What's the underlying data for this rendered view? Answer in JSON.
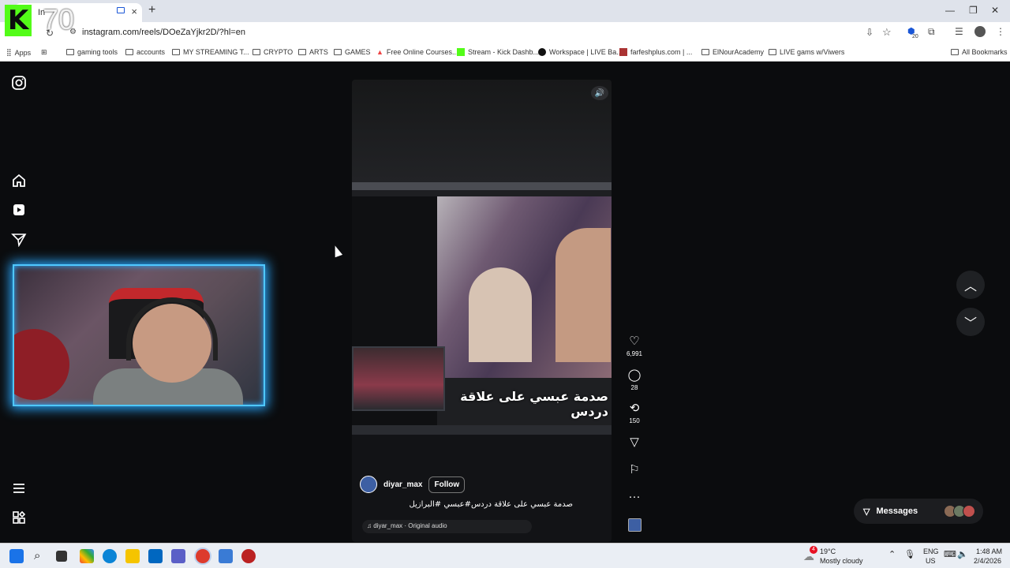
{
  "browser": {
    "tab_title": "In",
    "url": "instagram.com/reels/DOeZaYjkr2D/?hl=en",
    "bookmarks": [
      {
        "label": "Apps"
      },
      {
        "label": "gaming tools"
      },
      {
        "label": "accounts"
      },
      {
        "label": "MY STREAMING T..."
      },
      {
        "label": "CRYPTO"
      },
      {
        "label": "ARTS"
      },
      {
        "label": "GAMES"
      },
      {
        "label": "Free Online Courses..."
      },
      {
        "label": "Stream - Kick Dashb..."
      },
      {
        "label": "Workspace | LIVE Ba..."
      },
      {
        "label": "farfeshplus.com | ..."
      },
      {
        "label": "ElNourAcademy"
      },
      {
        "label": "LIVE gams w/Viwers"
      },
      {
        "label": "All Bookmarks"
      }
    ],
    "extension_badge": "20"
  },
  "overlay": {
    "logo_letter": "K",
    "viewer_count": "70"
  },
  "reel": {
    "video_caption": "صدمة عبسي على علاقة دردس",
    "author": "diyar_max",
    "follow_label": "Follow",
    "description": "صدمة عبسي على علاقة دردس#عبسي #البرازيل",
    "audio": "diyar_max · Original audio"
  },
  "actions": {
    "likes": "6,991",
    "comments": "28",
    "reposts": "150"
  },
  "messages": {
    "label": "Messages"
  },
  "taskbar": {
    "weather_temp": "19°C",
    "weather_desc": "Mostly cloudy",
    "weather_badge": "4",
    "lang_1": "ENG",
    "lang_2": "US",
    "time": "1:48 AM",
    "date": "2/4/2026"
  },
  "colors": {
    "page_bg": "#0b0c0e",
    "webcam_border": "#4fc8ff",
    "kick_green": "#53fc18",
    "notification_red": "#e81123"
  }
}
